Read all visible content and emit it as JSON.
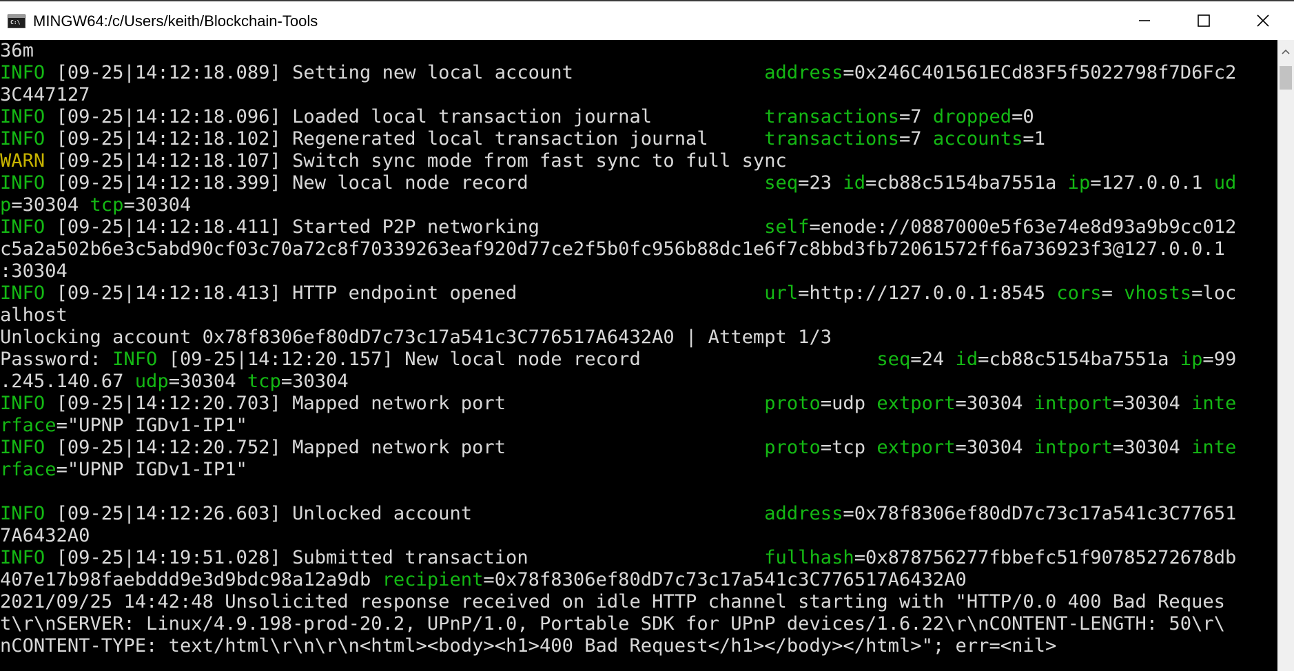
{
  "window": {
    "title": "MINGW64:/c/Users/keith/Blockchain-Tools",
    "icon_name": "terminal-icon",
    "controls": [
      "minimize-icon",
      "maximize-icon",
      "close-icon"
    ]
  },
  "colors": {
    "background": "#000000",
    "text": "#d8d8d8",
    "info": "#14b814",
    "warn": "#c8b400",
    "key": "#14b814"
  },
  "console": {
    "lines": [
      [
        {
          "t": "36m"
        }
      ],
      [
        {
          "t": "INFO",
          "c": "g"
        },
        {
          "t": " [09-25|14:12:18.089] Setting new local account                 "
        },
        {
          "t": "address",
          "c": "g"
        },
        {
          "t": "=0x246C401561ECd83F5f5022798f7D6Fc2"
        }
      ],
      [
        {
          "t": "3C447127"
        }
      ],
      [
        {
          "t": "INFO",
          "c": "g"
        },
        {
          "t": " [09-25|14:12:18.096] Loaded local transaction journal          "
        },
        {
          "t": "transactions",
          "c": "g"
        },
        {
          "t": "=7 "
        },
        {
          "t": "dropped",
          "c": "g"
        },
        {
          "t": "=0"
        }
      ],
      [
        {
          "t": "INFO",
          "c": "g"
        },
        {
          "t": " [09-25|14:12:18.102] Regenerated local transaction journal     "
        },
        {
          "t": "transactions",
          "c": "g"
        },
        {
          "t": "=7 "
        },
        {
          "t": "accounts",
          "c": "g"
        },
        {
          "t": "=1"
        }
      ],
      [
        {
          "t": "WARN",
          "c": "y"
        },
        {
          "t": " [09-25|14:12:18.107] Switch sync mode from fast sync to full sync"
        }
      ],
      [
        {
          "t": "INFO",
          "c": "g"
        },
        {
          "t": " [09-25|14:12:18.399] New local node record                     "
        },
        {
          "t": "seq",
          "c": "g"
        },
        {
          "t": "=23 "
        },
        {
          "t": "id",
          "c": "g"
        },
        {
          "t": "=cb88c5154ba7551a "
        },
        {
          "t": "ip",
          "c": "g"
        },
        {
          "t": "=127.0.0.1 "
        },
        {
          "t": "ud",
          "c": "g"
        }
      ],
      [
        {
          "t": "p",
          "c": "g"
        },
        {
          "t": "=30304 "
        },
        {
          "t": "tcp",
          "c": "g"
        },
        {
          "t": "=30304"
        }
      ],
      [
        {
          "t": "INFO",
          "c": "g"
        },
        {
          "t": " [09-25|14:12:18.411] Started P2P networking                    "
        },
        {
          "t": "self",
          "c": "g"
        },
        {
          "t": "=enode://0887000e5f63e74e8d93a9b9cc012"
        }
      ],
      [
        {
          "t": "c5a2a502b6e3c5abd90cf03c70a72c8f70339263eaf920d77ce2f5b0fc956b88dc1e6f7c8bbd3fb72061572ff6a736923f3@127.0.0.1"
        }
      ],
      [
        {
          "t": ":30304"
        }
      ],
      [
        {
          "t": "INFO",
          "c": "g"
        },
        {
          "t": " [09-25|14:12:18.413] HTTP endpoint opened                      "
        },
        {
          "t": "url",
          "c": "g"
        },
        {
          "t": "=http://127.0.0.1:8545 "
        },
        {
          "t": "cors",
          "c": "g"
        },
        {
          "t": "= "
        },
        {
          "t": "vhosts",
          "c": "g"
        },
        {
          "t": "=loc"
        }
      ],
      [
        {
          "t": "alhost"
        }
      ],
      [
        {
          "t": "Unlocking account 0x78f8306ef80dD7c73c17a541c3C776517A6432A0 | Attempt 1/3"
        }
      ],
      [
        {
          "t": "Password: "
        },
        {
          "t": "INFO",
          "c": "g"
        },
        {
          "t": " [09-25|14:12:20.157] New local node record                     "
        },
        {
          "t": "seq",
          "c": "g"
        },
        {
          "t": "=24 "
        },
        {
          "t": "id",
          "c": "g"
        },
        {
          "t": "=cb88c5154ba7551a "
        },
        {
          "t": "ip",
          "c": "g"
        },
        {
          "t": "=99"
        }
      ],
      [
        {
          "t": ".245.140.67 "
        },
        {
          "t": "udp",
          "c": "g"
        },
        {
          "t": "=30304 "
        },
        {
          "t": "tcp",
          "c": "g"
        },
        {
          "t": "=30304"
        }
      ],
      [
        {
          "t": "INFO",
          "c": "g"
        },
        {
          "t": " [09-25|14:12:20.703] Mapped network port                       "
        },
        {
          "t": "proto",
          "c": "g"
        },
        {
          "t": "=udp "
        },
        {
          "t": "extport",
          "c": "g"
        },
        {
          "t": "=30304 "
        },
        {
          "t": "intport",
          "c": "g"
        },
        {
          "t": "=30304 "
        },
        {
          "t": "inte",
          "c": "g"
        }
      ],
      [
        {
          "t": "rface",
          "c": "g"
        },
        {
          "t": "=\"UPNP IGDv1-IP1\""
        }
      ],
      [
        {
          "t": "INFO",
          "c": "g"
        },
        {
          "t": " [09-25|14:12:20.752] Mapped network port                       "
        },
        {
          "t": "proto",
          "c": "g"
        },
        {
          "t": "=tcp "
        },
        {
          "t": "extport",
          "c": "g"
        },
        {
          "t": "=30304 "
        },
        {
          "t": "intport",
          "c": "g"
        },
        {
          "t": "=30304 "
        },
        {
          "t": "inte",
          "c": "g"
        }
      ],
      [
        {
          "t": "rface",
          "c": "g"
        },
        {
          "t": "=\"UPNP IGDv1-IP1\""
        }
      ],
      [
        {
          "t": ""
        }
      ],
      [
        {
          "t": "INFO",
          "c": "g"
        },
        {
          "t": " [09-25|14:12:26.603] Unlocked account                          "
        },
        {
          "t": "address",
          "c": "g"
        },
        {
          "t": "=0x78f8306ef80dD7c73c17a541c3C77651"
        }
      ],
      [
        {
          "t": "7A6432A0"
        }
      ],
      [
        {
          "t": "INFO",
          "c": "g"
        },
        {
          "t": " [09-25|14:19:51.028] Submitted transaction                     "
        },
        {
          "t": "fullhash",
          "c": "g"
        },
        {
          "t": "=0x878756277fbbefc51f90785272678db"
        }
      ],
      [
        {
          "t": "407e17b98faebddd9e3d9bdc98a12a9db "
        },
        {
          "t": "recipient",
          "c": "g"
        },
        {
          "t": "=0x78f8306ef80dD7c73c17a541c3C776517A6432A0"
        }
      ],
      [
        {
          "t": "2021/09/25 14:42:48 Unsolicited response received on idle HTTP channel starting with \"HTTP/0.0 400 Bad Reques"
        }
      ],
      [
        {
          "t": "t\\r\\nSERVER: Linux/4.9.198-prod-20.2, UPnP/1.0, Portable SDK for UPnP devices/1.6.22\\r\\nCONTENT-LENGTH: 50\\r\\"
        }
      ],
      [
        {
          "t": "nCONTENT-TYPE: text/html\\r\\n\\r\\n<html><body><h1>400 Bad Request</h1></body></html>\"; err=<nil>"
        }
      ]
    ]
  }
}
